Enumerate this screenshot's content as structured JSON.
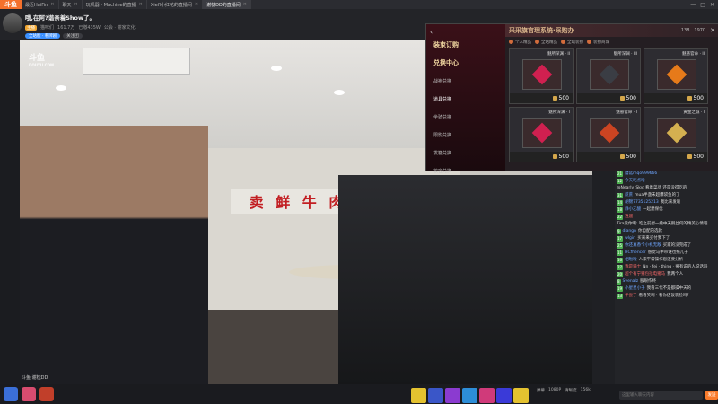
{
  "tabs": [
    {
      "label": "斗鱼",
      "logo": true
    },
    {
      "label": "最近HaiFin",
      "active": false
    },
    {
      "label": "聊天",
      "active": false
    },
    {
      "label": "玩机器 - Machine的直播",
      "active": false
    },
    {
      "label": "Xiefl小红花的直播间",
      "active": false
    },
    {
      "label": "谢枕DD的直播间",
      "active": true
    }
  ],
  "room": {
    "title": "哦,在阿?谐亲着Show了。",
    "hot": "161.7万",
    "followers": "已缴435W",
    "guild": "公会 · 谢家文化",
    "badge": "主播",
    "badge2": "猫咪们",
    "follow_label": "关注团",
    "subscribe_label": "全站脸 · 看牌剧"
  },
  "video": {
    "sign": "卖 鲜 牛 肉",
    "logo": "斗鱼",
    "logo_sub": "DOUYU.COM",
    "watermark": "斗鱼 谢枕DD"
  },
  "store": {
    "logo": "装束订购",
    "title": "采采旗官理系统·采购办",
    "currency_a": "138",
    "currency_b": "1970",
    "back": "‹",
    "close": "✕",
    "side": [
      {
        "label": "装束订购",
        "main": true
      },
      {
        "label": "兑换中心",
        "main": true
      },
      {
        "label": "战袍兑换",
        "main": false
      },
      {
        "label": "道具兑换",
        "main": false,
        "sel": true
      },
      {
        "label": "坐骑兑换",
        "main": false
      },
      {
        "label": "限影兑换",
        "main": false
      },
      {
        "label": "发簪兑换",
        "main": false
      },
      {
        "label": "妆容兑换",
        "main": false
      }
    ],
    "tabs": [
      "个人精品",
      "全站精品",
      "全站装扮",
      "装扮商城"
    ],
    "items": [
      {
        "name": "魅所深渊 · II",
        "price": "500",
        "gem": "#d02050"
      },
      {
        "name": "魅所深渊 · III",
        "price": "500",
        "gem": "#3a3d44"
      },
      {
        "name": "魅惑官命 · II",
        "price": "500",
        "gem": "#e67a1a"
      },
      {
        "name": "魅所深渊 · I",
        "price": "500",
        "gem": "#d02050"
      },
      {
        "name": "魅惑官命 · I",
        "price": "500",
        "gem": "#cc4422"
      },
      {
        "name": "黄金之城 · I",
        "price": "500",
        "gem": "#d4b050"
      }
    ]
  },
  "chat": [
    {
      "user": "蘑菇mqo999666",
      "text": "",
      "lvl": "21"
    },
    {
      "user": "今天吃点啥",
      "text": "@Nearly_Sky: 看着菜品 还是没得吃的",
      "lvl": "12"
    },
    {
      "user": "蔗蔗",
      "text": "mua半盏未超爆袋鱼的了",
      "lvl": "31"
    },
    {
      "user": "胡锦7735125213",
      "text": "我比来发吸",
      "lvl": "14"
    },
    {
      "user": "静小乙酸",
      "text": "一起建保优",
      "lvl": "18"
    },
    {
      "user": "逍遥",
      "text": "Tira爱你啊: 吃之前想一撸中天鹅丝何的精美心情吧",
      "lvl": "22",
      "red": true
    },
    {
      "user": "diangn",
      "text": "你自配的选款",
      "lvl": "9"
    },
    {
      "user": "wlgirl",
      "text": "买来来买付我下了",
      "lvl": "17"
    },
    {
      "user": "你还真香个小机无敌",
      "text": "买家的没完成了",
      "lvl": "25"
    },
    {
      "user": "HCfhencer",
      "text": "感觉马甲带谁也拖儿子",
      "lvl": "11"
    },
    {
      "user": "相啦啦",
      "text": "人家平常操作您还要分析",
      "lvl": "16"
    },
    {
      "user": "我是骑士",
      "text": "Nn · fei · thing · 要有说的人说话吗",
      "lvl": "27",
      "red": true
    },
    {
      "user": "超个有宁猪包括电猪马",
      "text": "我两个人",
      "lvl": "20",
      "red": true
    },
    {
      "user": "Svenalz",
      "text": "服眼作终",
      "lvl": "8"
    },
    {
      "user": "小星星小子",
      "text": "我看三代不是都操中天的",
      "lvl": "19"
    },
    {
      "user": "半尝了",
      "text": "看看笑啊 · 看你这饭装脸吗?",
      "lvl": "13",
      "red": true
    }
  ],
  "bottom": {
    "chat_placeholder": "这里输入聊天内容",
    "send": "发送",
    "ctrl": [
      "弹幕",
      "1080P",
      "清晰度",
      "156k"
    ]
  }
}
